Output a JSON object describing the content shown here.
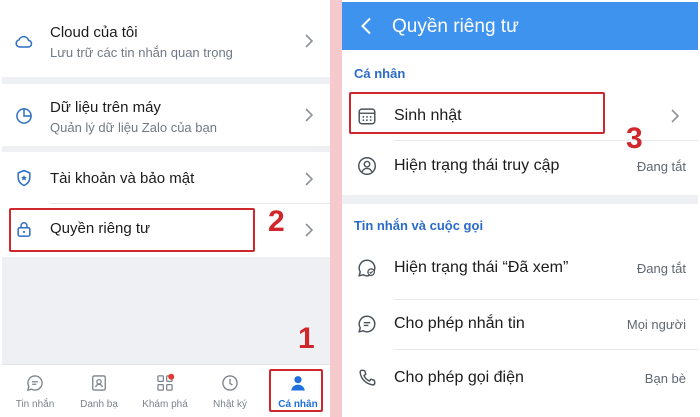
{
  "left_panel": {
    "items": [
      {
        "title": "Cloud của tôi",
        "subtitle": "Lưu trữ các tin nhắn quan trọng",
        "icon": "cloud-icon"
      },
      {
        "title": "Dữ liệu trên máy",
        "subtitle": "Quản lý dữ liệu Zalo của bạn",
        "icon": "pie-chart-icon"
      },
      {
        "title": "Tài khoản và bảo mật",
        "icon": "shield-icon"
      },
      {
        "title": "Quyền riêng tư",
        "icon": "lock-icon"
      }
    ],
    "step_labels": {
      "privacy": "2",
      "profile": "1"
    },
    "bottom_nav": [
      {
        "label": "Tin nhắn",
        "icon": "chat-icon"
      },
      {
        "label": "Danh bạ",
        "icon": "contacts-icon"
      },
      {
        "label": "Khám phá",
        "icon": "grid-icon"
      },
      {
        "label": "Nhật ký",
        "icon": "clock-icon"
      },
      {
        "label": "Cá nhân",
        "icon": "person-icon",
        "active": true
      }
    ]
  },
  "right_panel": {
    "header_title": "Quyền riêng tư",
    "section_personal": {
      "label": "Cá nhân",
      "items": [
        {
          "title": "Sinh nhật",
          "icon": "calendar-icon"
        },
        {
          "title": "Hiện trạng thái truy cập",
          "value": "Đang tắt",
          "icon": "user-status-icon"
        }
      ]
    },
    "section_messages": {
      "label": "Tin nhắn và cuộc gọi",
      "items": [
        {
          "title": "Hiện trạng thái “Đã xem”",
          "value": "Đang tắt",
          "icon": "seen-status-icon"
        },
        {
          "title": "Cho phép nhắn tin",
          "value": "Mọi người",
          "icon": "message-icon"
        },
        {
          "title": "Cho phép gọi điện",
          "value": "Bạn bè",
          "icon": "phone-icon"
        }
      ]
    },
    "step_label": "3"
  },
  "colors": {
    "accent": "#3e93ee",
    "highlight": "#d0272d",
    "section_label": "#2a6bc9"
  }
}
